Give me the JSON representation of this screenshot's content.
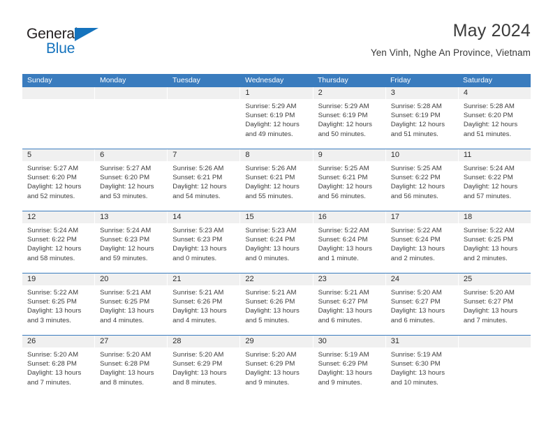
{
  "brand": {
    "name_top": "General",
    "name_bottom": "Blue",
    "accent_color": "#1573bd",
    "triangle_icon": "triangle-right-icon"
  },
  "header": {
    "title": "May 2024",
    "subtitle": "Yen Vinh, Nghe An Province, Vietnam"
  },
  "calendar": {
    "header_bg": "#3a7cbe",
    "daynum_bg": "#f0f0f0",
    "weekdays": [
      "Sunday",
      "Monday",
      "Tuesday",
      "Wednesday",
      "Thursday",
      "Friday",
      "Saturday"
    ],
    "weeks": [
      [
        {
          "day": "",
          "empty": true,
          "sunrise": "",
          "sunset": "",
          "daylight1": "",
          "daylight2": ""
        },
        {
          "day": "",
          "empty": true,
          "sunrise": "",
          "sunset": "",
          "daylight1": "",
          "daylight2": ""
        },
        {
          "day": "",
          "empty": true,
          "sunrise": "",
          "sunset": "",
          "daylight1": "",
          "daylight2": ""
        },
        {
          "day": "1",
          "empty": false,
          "sunrise": "Sunrise: 5:29 AM",
          "sunset": "Sunset: 6:19 PM",
          "daylight1": "Daylight: 12 hours",
          "daylight2": "and 49 minutes."
        },
        {
          "day": "2",
          "empty": false,
          "sunrise": "Sunrise: 5:29 AM",
          "sunset": "Sunset: 6:19 PM",
          "daylight1": "Daylight: 12 hours",
          "daylight2": "and 50 minutes."
        },
        {
          "day": "3",
          "empty": false,
          "sunrise": "Sunrise: 5:28 AM",
          "sunset": "Sunset: 6:19 PM",
          "daylight1": "Daylight: 12 hours",
          "daylight2": "and 51 minutes."
        },
        {
          "day": "4",
          "empty": false,
          "sunrise": "Sunrise: 5:28 AM",
          "sunset": "Sunset: 6:20 PM",
          "daylight1": "Daylight: 12 hours",
          "daylight2": "and 51 minutes."
        }
      ],
      [
        {
          "day": "5",
          "empty": false,
          "sunrise": "Sunrise: 5:27 AM",
          "sunset": "Sunset: 6:20 PM",
          "daylight1": "Daylight: 12 hours",
          "daylight2": "and 52 minutes."
        },
        {
          "day": "6",
          "empty": false,
          "sunrise": "Sunrise: 5:27 AM",
          "sunset": "Sunset: 6:20 PM",
          "daylight1": "Daylight: 12 hours",
          "daylight2": "and 53 minutes."
        },
        {
          "day": "7",
          "empty": false,
          "sunrise": "Sunrise: 5:26 AM",
          "sunset": "Sunset: 6:21 PM",
          "daylight1": "Daylight: 12 hours",
          "daylight2": "and 54 minutes."
        },
        {
          "day": "8",
          "empty": false,
          "sunrise": "Sunrise: 5:26 AM",
          "sunset": "Sunset: 6:21 PM",
          "daylight1": "Daylight: 12 hours",
          "daylight2": "and 55 minutes."
        },
        {
          "day": "9",
          "empty": false,
          "sunrise": "Sunrise: 5:25 AM",
          "sunset": "Sunset: 6:21 PM",
          "daylight1": "Daylight: 12 hours",
          "daylight2": "and 56 minutes."
        },
        {
          "day": "10",
          "empty": false,
          "sunrise": "Sunrise: 5:25 AM",
          "sunset": "Sunset: 6:22 PM",
          "daylight1": "Daylight: 12 hours",
          "daylight2": "and 56 minutes."
        },
        {
          "day": "11",
          "empty": false,
          "sunrise": "Sunrise: 5:24 AM",
          "sunset": "Sunset: 6:22 PM",
          "daylight1": "Daylight: 12 hours",
          "daylight2": "and 57 minutes."
        }
      ],
      [
        {
          "day": "12",
          "empty": false,
          "sunrise": "Sunrise: 5:24 AM",
          "sunset": "Sunset: 6:22 PM",
          "daylight1": "Daylight: 12 hours",
          "daylight2": "and 58 minutes."
        },
        {
          "day": "13",
          "empty": false,
          "sunrise": "Sunrise: 5:24 AM",
          "sunset": "Sunset: 6:23 PM",
          "daylight1": "Daylight: 12 hours",
          "daylight2": "and 59 minutes."
        },
        {
          "day": "14",
          "empty": false,
          "sunrise": "Sunrise: 5:23 AM",
          "sunset": "Sunset: 6:23 PM",
          "daylight1": "Daylight: 13 hours",
          "daylight2": "and 0 minutes."
        },
        {
          "day": "15",
          "empty": false,
          "sunrise": "Sunrise: 5:23 AM",
          "sunset": "Sunset: 6:24 PM",
          "daylight1": "Daylight: 13 hours",
          "daylight2": "and 0 minutes."
        },
        {
          "day": "16",
          "empty": false,
          "sunrise": "Sunrise: 5:22 AM",
          "sunset": "Sunset: 6:24 PM",
          "daylight1": "Daylight: 13 hours",
          "daylight2": "and 1 minute."
        },
        {
          "day": "17",
          "empty": false,
          "sunrise": "Sunrise: 5:22 AM",
          "sunset": "Sunset: 6:24 PM",
          "daylight1": "Daylight: 13 hours",
          "daylight2": "and 2 minutes."
        },
        {
          "day": "18",
          "empty": false,
          "sunrise": "Sunrise: 5:22 AM",
          "sunset": "Sunset: 6:25 PM",
          "daylight1": "Daylight: 13 hours",
          "daylight2": "and 2 minutes."
        }
      ],
      [
        {
          "day": "19",
          "empty": false,
          "sunrise": "Sunrise: 5:22 AM",
          "sunset": "Sunset: 6:25 PM",
          "daylight1": "Daylight: 13 hours",
          "daylight2": "and 3 minutes."
        },
        {
          "day": "20",
          "empty": false,
          "sunrise": "Sunrise: 5:21 AM",
          "sunset": "Sunset: 6:25 PM",
          "daylight1": "Daylight: 13 hours",
          "daylight2": "and 4 minutes."
        },
        {
          "day": "21",
          "empty": false,
          "sunrise": "Sunrise: 5:21 AM",
          "sunset": "Sunset: 6:26 PM",
          "daylight1": "Daylight: 13 hours",
          "daylight2": "and 4 minutes."
        },
        {
          "day": "22",
          "empty": false,
          "sunrise": "Sunrise: 5:21 AM",
          "sunset": "Sunset: 6:26 PM",
          "daylight1": "Daylight: 13 hours",
          "daylight2": "and 5 minutes."
        },
        {
          "day": "23",
          "empty": false,
          "sunrise": "Sunrise: 5:21 AM",
          "sunset": "Sunset: 6:27 PM",
          "daylight1": "Daylight: 13 hours",
          "daylight2": "and 6 minutes."
        },
        {
          "day": "24",
          "empty": false,
          "sunrise": "Sunrise: 5:20 AM",
          "sunset": "Sunset: 6:27 PM",
          "daylight1": "Daylight: 13 hours",
          "daylight2": "and 6 minutes."
        },
        {
          "day": "25",
          "empty": false,
          "sunrise": "Sunrise: 5:20 AM",
          "sunset": "Sunset: 6:27 PM",
          "daylight1": "Daylight: 13 hours",
          "daylight2": "and 7 minutes."
        }
      ],
      [
        {
          "day": "26",
          "empty": false,
          "sunrise": "Sunrise: 5:20 AM",
          "sunset": "Sunset: 6:28 PM",
          "daylight1": "Daylight: 13 hours",
          "daylight2": "and 7 minutes."
        },
        {
          "day": "27",
          "empty": false,
          "sunrise": "Sunrise: 5:20 AM",
          "sunset": "Sunset: 6:28 PM",
          "daylight1": "Daylight: 13 hours",
          "daylight2": "and 8 minutes."
        },
        {
          "day": "28",
          "empty": false,
          "sunrise": "Sunrise: 5:20 AM",
          "sunset": "Sunset: 6:29 PM",
          "daylight1": "Daylight: 13 hours",
          "daylight2": "and 8 minutes."
        },
        {
          "day": "29",
          "empty": false,
          "sunrise": "Sunrise: 5:20 AM",
          "sunset": "Sunset: 6:29 PM",
          "daylight1": "Daylight: 13 hours",
          "daylight2": "and 9 minutes."
        },
        {
          "day": "30",
          "empty": false,
          "sunrise": "Sunrise: 5:19 AM",
          "sunset": "Sunset: 6:29 PM",
          "daylight1": "Daylight: 13 hours",
          "daylight2": "and 9 minutes."
        },
        {
          "day": "31",
          "empty": false,
          "sunrise": "Sunrise: 5:19 AM",
          "sunset": "Sunset: 6:30 PM",
          "daylight1": "Daylight: 13 hours",
          "daylight2": "and 10 minutes."
        },
        {
          "day": "",
          "empty": true,
          "sunrise": "",
          "sunset": "",
          "daylight1": "",
          "daylight2": ""
        }
      ]
    ]
  }
}
